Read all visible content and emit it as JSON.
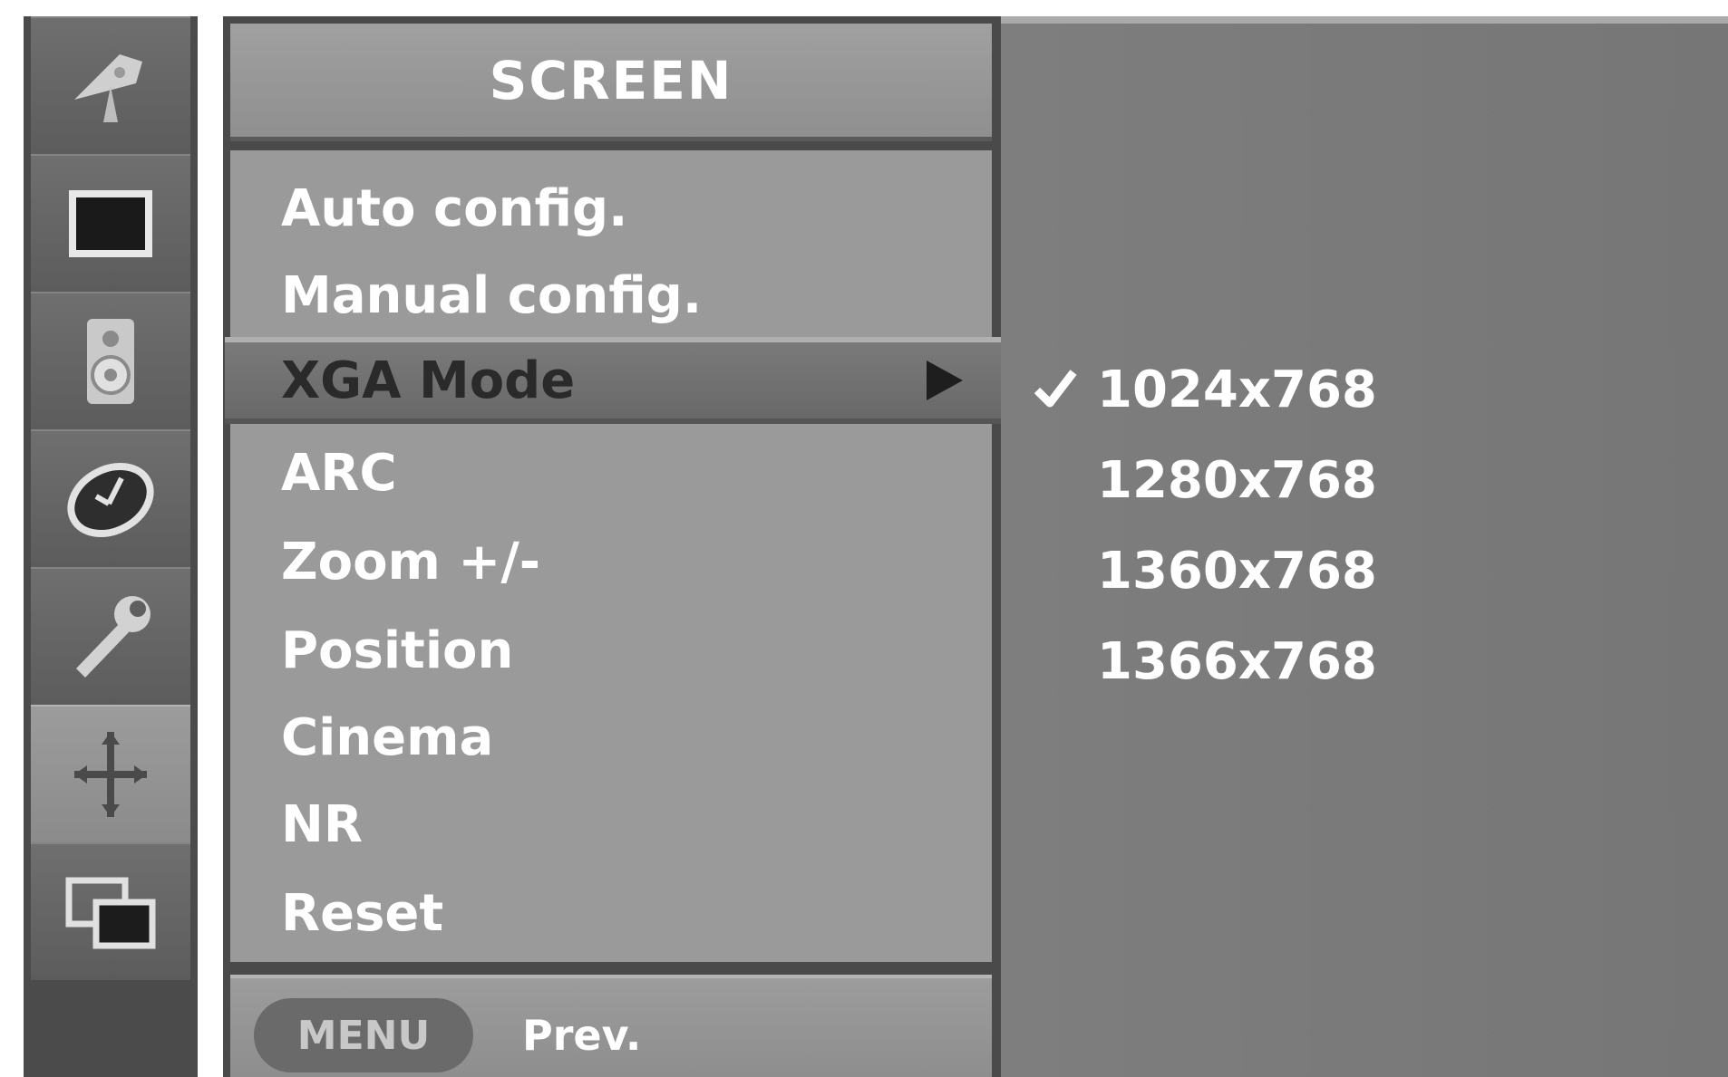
{
  "rail": {
    "items": [
      {
        "icon": "satellite-dish-icon",
        "active": false
      },
      {
        "icon": "picture-icon",
        "active": false
      },
      {
        "icon": "speaker-icon",
        "active": false
      },
      {
        "icon": "time-icon",
        "active": false
      },
      {
        "icon": "option-wrench-icon",
        "active": false
      },
      {
        "icon": "screen-move-icon",
        "active": true
      },
      {
        "icon": "pip-windows-icon",
        "active": false
      }
    ]
  },
  "menu": {
    "title": "SCREEN",
    "items": [
      {
        "label": "Auto config."
      },
      {
        "label": "Manual config."
      },
      {
        "label": "XGA Mode",
        "selected": true,
        "has_submenu": true
      },
      {
        "label": "ARC"
      },
      {
        "label": "Zoom +/-"
      },
      {
        "label": "Position"
      },
      {
        "label": "Cinema"
      },
      {
        "label": "NR"
      },
      {
        "label": "Reset"
      }
    ],
    "footer": {
      "button_label": "MENU",
      "hint": "Prev."
    }
  },
  "submenu": {
    "options": [
      {
        "label": "1024x768",
        "checked": true
      },
      {
        "label": "1280x768",
        "checked": false
      },
      {
        "label": "1360x768",
        "checked": false
      },
      {
        "label": "1366x768",
        "checked": false
      }
    ]
  },
  "colors": {
    "menu_item_bg": "#9a9a9a",
    "selected_bg": "#707070",
    "submenu_bg": "#7a7a7a",
    "text": "#ffffff"
  }
}
